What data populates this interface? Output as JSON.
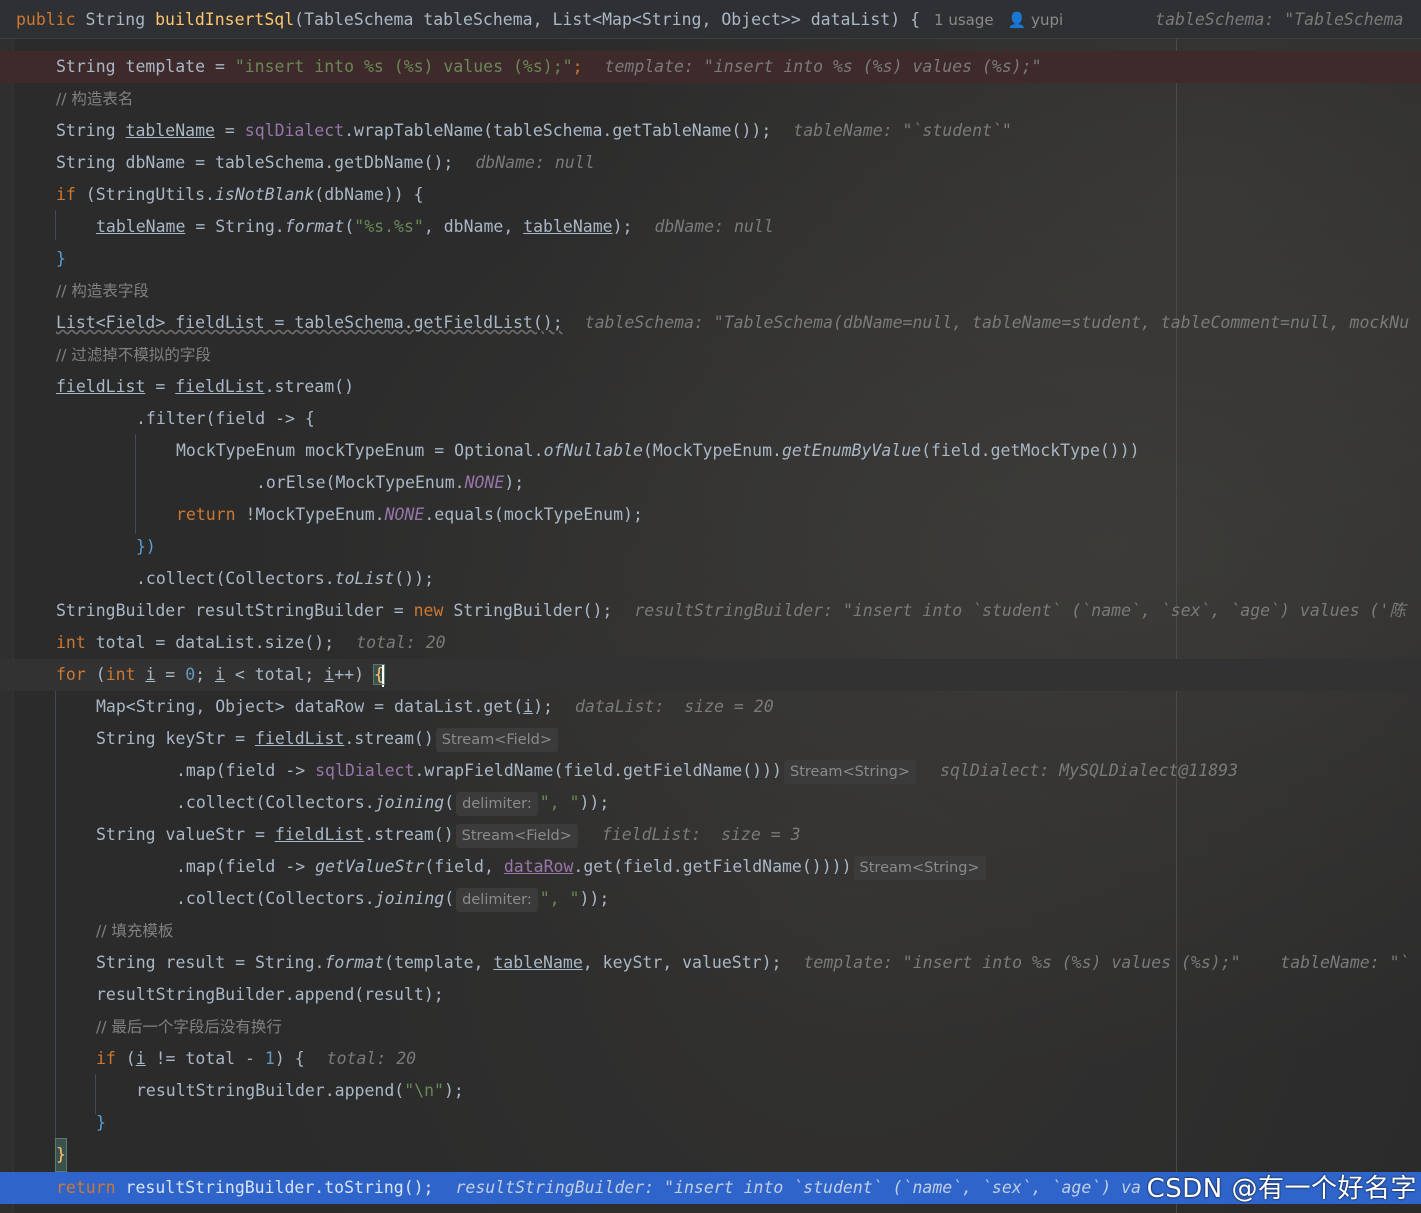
{
  "sticky": {
    "text_public": "public",
    "text_string": "String",
    "method": "buildInsertSql",
    "params": "(TableSchema tableSchema, List<Map<String, Object>> dataList) {",
    "usage": "1 usage",
    "author": "yupi",
    "hint": "tableSchema: \"TableSchema"
  },
  "lines": {
    "l1_a": "String template = ",
    "l1_s": "\"insert into %s (%s) values (%s);\"",
    "l1_e": ";",
    "l1_h": "template: \"insert into %s (%s) values (%s);\"",
    "l2": "// 构造表名",
    "l3_a": "String ",
    "l3_v": "tableName",
    "l3_b": " = ",
    "l3_f": "sqlDialect",
    "l3_c": ".wrapTableName(tableSchema.getTableName());",
    "l3_h": "tableName: \"`student`\"",
    "l4_a": "String dbName = tableSchema.getDbName();",
    "l4_h": "dbName: null",
    "l5_k": "if",
    "l5_a": " (StringUtils.",
    "l5_i": "isNotBlank",
    "l5_b": "(dbName)) {",
    "l6_v": "tableName",
    "l6_a": " = String.",
    "l6_i": "format",
    "l6_b": "(",
    "l6_s": "\"%s.%s\"",
    "l6_c": ", dbName, ",
    "l6_v2": "tableName",
    "l6_d": ");",
    "l6_h": "dbName: null",
    "l7": "}",
    "l8": "// 构造表字段",
    "l9_a": "List<Field> fieldList = tableSchema.getFieldList();",
    "l9_h": "tableSchema: \"TableSchema(dbName=null, tableName=student, tableComment=null, mockNu",
    "l10": "// 过滤掉不模拟的字段",
    "l11_v": "fieldList",
    "l11_a": " = ",
    "l11_v2": "fieldList",
    "l11_b": ".stream()",
    "l12_a": ".filter(field -> {",
    "l13_a": "MockTypeEnum mockTypeEnum = Optional.",
    "l13_i": "ofNullable",
    "l13_b": "(MockTypeEnum.",
    "l13_i2": "getEnumByValue",
    "l13_c": "(field.getMockType()))",
    "l14_a": ".orElse(MockTypeEnum.",
    "l14_f": "NONE",
    "l14_b": ");",
    "l15_k": "return",
    "l15_a": " !MockTypeEnum.",
    "l15_f": "NONE",
    "l15_b": ".equals(mockTypeEnum);",
    "l16": "})",
    "l17_a": ".collect(Collectors.",
    "l17_i": "toList",
    "l17_b": "());",
    "l18_a": "StringBuilder resultStringBuilder = ",
    "l18_k": "new",
    "l18_b": " StringBuilder();",
    "l18_h": "resultStringBuilder: \"insert into `student` (`name`, `sex`, `age`) values ('陈",
    "l19_k": "int",
    "l19_a": " total = dataList.size();",
    "l19_h": "total: 20",
    "l20_k": "for",
    "l20_a": " (",
    "l20_k2": "int",
    "l20_b": " ",
    "l20_v": "i",
    "l20_c": " = ",
    "l20_n": "0",
    "l20_d": "; ",
    "l20_v2": "i",
    "l20_e": " < total; ",
    "l20_v3": "i",
    "l20_f": "++) ",
    "l20_br": "{",
    "l21_a": "Map<String, Object> dataRow = dataList.get(",
    "l21_v": "i",
    "l21_b": ");",
    "l21_h": "dataList:  size = 20",
    "l22_a": "String keyStr = ",
    "l22_v": "fieldList",
    "l22_b": ".stream()",
    "l22_t": "Stream<Field>",
    "l23_a": ".map(field -> ",
    "l23_f": "sqlDialect",
    "l23_b": ".wrapFieldName(field.getFieldName()))",
    "l23_t": "Stream<String>",
    "l23_h": "sqlDialect: MySQLDialect@11893",
    "l24_a": ".collect(Collectors.",
    "l24_i": "joining",
    "l24_b": "(",
    "l24_t": "delimiter:",
    "l24_s": "\", \"",
    "l24_c": "));",
    "l25_a": "String valueStr = ",
    "l25_v": "fieldList",
    "l25_b": ".stream()",
    "l25_t": "Stream<Field>",
    "l25_h": "fieldList:  size = 3",
    "l26_a": ".map(field -> ",
    "l26_i": "getValueStr",
    "l26_b": "(field, ",
    "l26_v": "dataRow",
    "l26_c": ".get(field.getFieldName())))",
    "l26_t": "Stream<String>",
    "l27_a": ".collect(Collectors.",
    "l27_i": "joining",
    "l27_b": "(",
    "l27_t": "delimiter:",
    "l27_s": "\", \"",
    "l27_c": "));",
    "l28": "// 填充模板",
    "l29_a": "String result = String.",
    "l29_i": "format",
    "l29_b": "(template, ",
    "l29_v": "tableName",
    "l29_c": ", keyStr, valueStr);",
    "l29_h": "template: \"insert into %s (%s) values (%s);\"    tableName: \"`",
    "l30_a": "resultStringBuilder.append(result);",
    "l31": "// 最后一个字段后没有换行",
    "l32_k": "if",
    "l32_a": " (",
    "l32_v": "i",
    "l32_b": " != total - ",
    "l32_n": "1",
    "l32_c": ") {",
    "l32_h": "total: 20",
    "l33_a": "resultStringBuilder.append(",
    "l33_s": "\"\\n\"",
    "l33_b": ");",
    "l34": "}",
    "l35": "}",
    "l36_k": "return",
    "l36_a": " resultStringBuilder.toString();",
    "l36_h": "resultStringBuilder: \"insert into `student` (`name`, `sex`, `age`) va"
  },
  "watermark": "CSDN @有一个好名字",
  "colors": {
    "background": "#2b2b2b",
    "keyword": "#cc7832",
    "string": "#6a8759",
    "method_decl": "#ffc66d",
    "field": "#9876aa",
    "number": "#6897bb",
    "execution_line": "#2f65ca",
    "error_line": "#3e2a2a"
  }
}
